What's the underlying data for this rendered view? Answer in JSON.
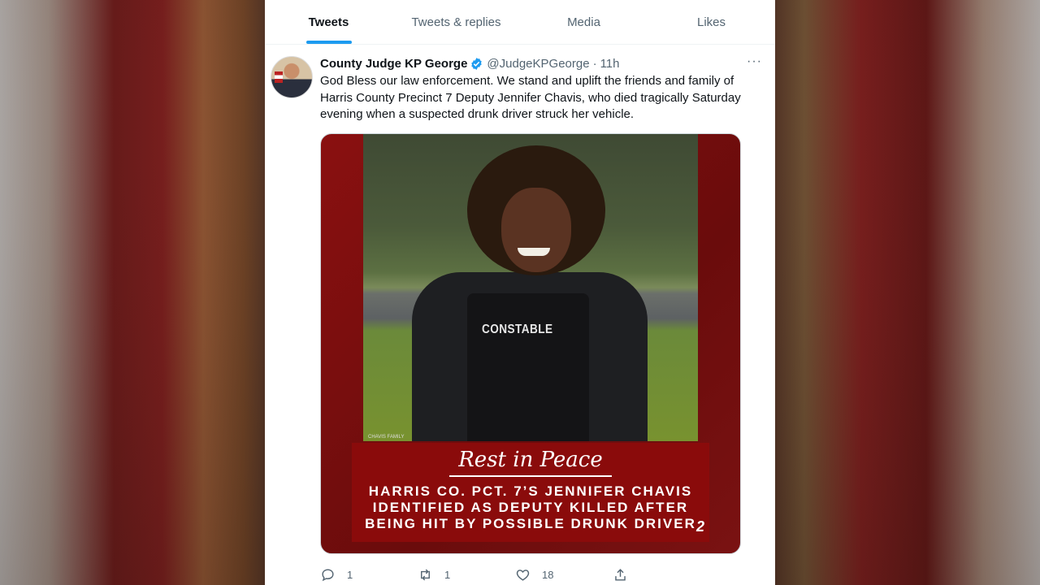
{
  "tabs": [
    "Tweets",
    "Tweets & replies",
    "Media",
    "Likes"
  ],
  "active_tab": "Tweets",
  "colors": {
    "accent": "#1d9bf0",
    "text": "#0f1419",
    "muted": "#536471"
  },
  "tweet": {
    "author_name": "County Judge KP George",
    "handle": "@JudgeKPGeorge",
    "separator": "·",
    "time": "11h",
    "more": "···",
    "text": "God Bless our law enforcement. We stand and uplift the friends and family of Harris County Precinct 7 Deputy Jennifer Chavis, who died tragically Saturday evening when a suspected drunk driver struck her vehicle.",
    "image": {
      "vest_text": "CONSTABLE",
      "credit": "CHAVIS FAMILY",
      "banner_title": "Rest in Peace",
      "banner_lines": [
        "HARRIS CO. PCT. 7’S JENNIFER CHAVIS",
        "IDENTIFIED AS DEPUTY KILLED AFTER",
        "BEING HIT BY POSSIBLE DRUNK DRIVER"
      ],
      "station_logo": "2"
    },
    "actions": {
      "replies": "1",
      "retweets": "1",
      "likes": "18"
    },
    "icons": [
      "reply-icon",
      "retweet-icon",
      "like-icon",
      "share-icon",
      "verified-badge-icon",
      "more-icon"
    ]
  }
}
